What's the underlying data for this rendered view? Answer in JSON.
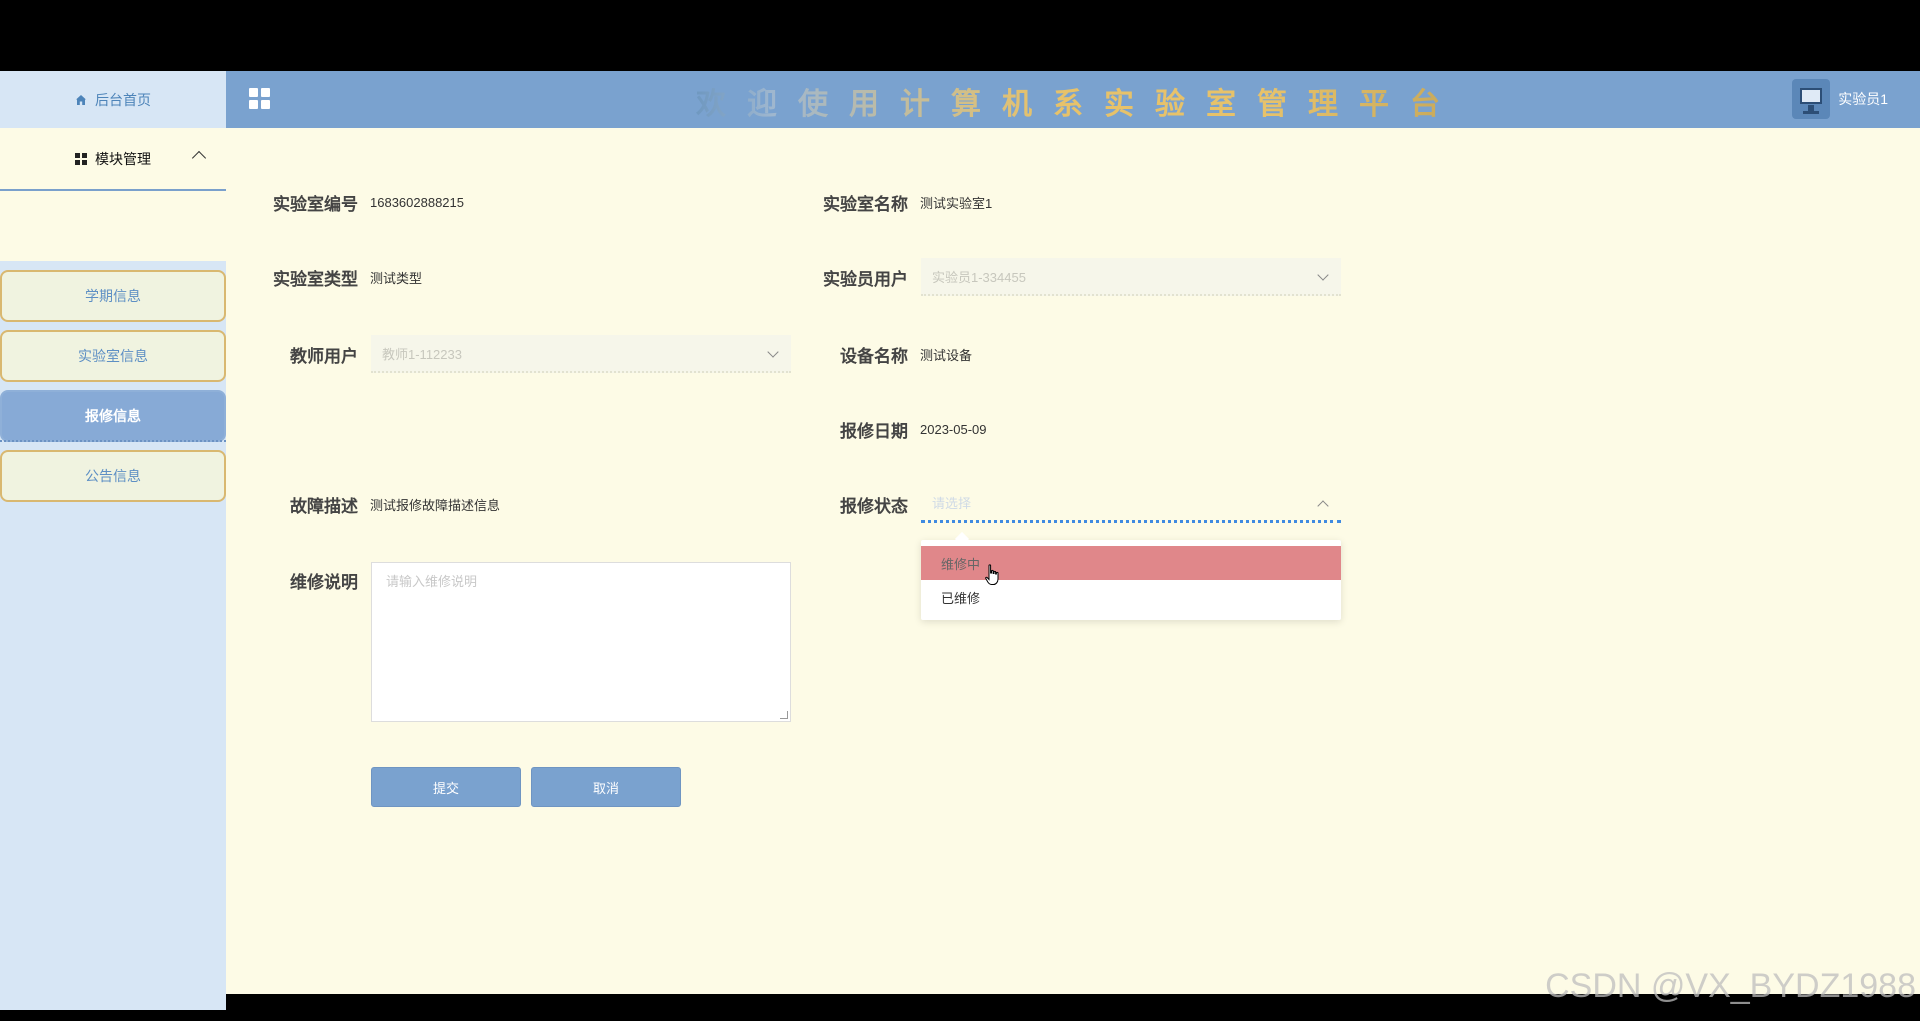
{
  "sidebar": {
    "home_label": "后台首页",
    "module_label": "模块管理",
    "items": [
      {
        "label": "学期信息",
        "active": false
      },
      {
        "label": "实验室信息",
        "active": false
      },
      {
        "label": "报修信息",
        "active": true
      },
      {
        "label": "公告信息",
        "active": false
      }
    ]
  },
  "header": {
    "title": "欢迎使用计算机系实验室管理平台",
    "username": "实验员1"
  },
  "form": {
    "lab_no": {
      "label": "实验室编号",
      "value": "1683602888215"
    },
    "lab_name": {
      "label": "实验室名称",
      "value": "测试实验室1"
    },
    "lab_type": {
      "label": "实验室类型",
      "value": "测试类型"
    },
    "lab_user": {
      "label": "实验员用户",
      "value": "实验员1-334455"
    },
    "teacher": {
      "label": "教师用户",
      "value": "教师1-112233"
    },
    "device": {
      "label": "设备名称",
      "value": "测试设备"
    },
    "repair_date": {
      "label": "报修日期",
      "value": "2023-05-09"
    },
    "fault_desc": {
      "label": "故障描述",
      "value": "测试报修故障描述信息"
    },
    "repair_status": {
      "label": "报修状态",
      "placeholder": "请选择",
      "options": [
        "维修中",
        "已维修"
      ]
    },
    "repair_note": {
      "label": "维修说明",
      "placeholder": "请输入维修说明"
    },
    "submit_label": "提交",
    "cancel_label": "取消"
  },
  "watermark": "CSDN @VX_BYDZ1988",
  "colors": {
    "header_bg": "#7aa2cf",
    "sidebar_bg": "#d7e6f5",
    "content_bg": "#fdfbe6",
    "active_menu": "#87aad6",
    "option_hover": "#e0878a",
    "focus_underline": "#3f8ae0"
  }
}
